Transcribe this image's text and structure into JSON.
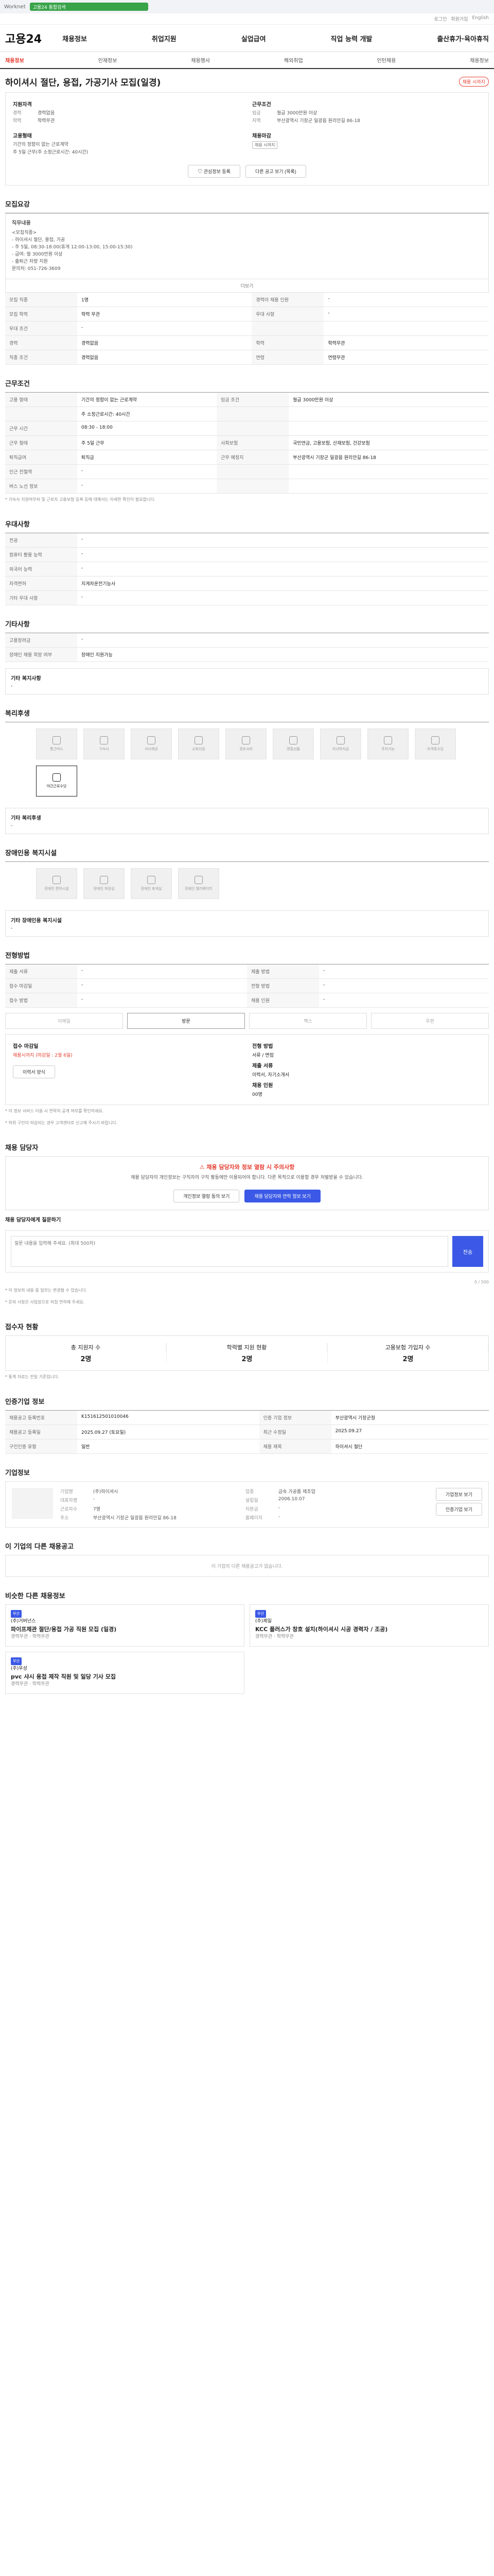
{
  "topbar": {
    "site": "Worknet",
    "search": "고용24 통합검색"
  },
  "util": [
    "로그인",
    "회원가입",
    "English"
  ],
  "header": {
    "logo": "고용24",
    "menu": [
      "채용정보",
      "취업지원",
      "실업급여",
      "직업 능력 개발",
      "출산휴가·육아휴직"
    ]
  },
  "subnav": [
    "채용정보",
    "인재정보",
    "채용행사",
    "해외취업",
    "인턴채용",
    "채용정보"
  ],
  "title": "하이셔시 절단, 용접, 가공기사 모집(일경)",
  "title_badge": "채용 시까지",
  "summary": {
    "left_label": "지원자격",
    "left": [
      [
        "경력",
        "경력없음"
      ],
      [
        "학력",
        "학력무관"
      ]
    ],
    "right_label": "근무조건",
    "right": [
      [
        "임금",
        "월급 3000만원 이상"
      ],
      [
        "지역",
        "부산광역시 기장군 일광읍 원리안길 86-18"
      ]
    ],
    "left2_label": "고용형태",
    "left2": [
      [
        "",
        "기간의 정함이 없는 근로계약"
      ],
      [
        "",
        "주 5일 근무(주 소정근로시간: 40시간)"
      ]
    ],
    "right2_label": "채용마감",
    "right2_tag": "채용 시까지"
  },
  "actions": {
    "scrap": "관심정보 등록",
    "share": "다른 공고 보기 (목록)"
  },
  "sec_requirements": "모집요강",
  "job_desc_label": "직무내용",
  "job_desc": [
    "<모집직종>",
    "- 하이셔시 절단, 용접, 가공",
    "- 주 5일, 08:30-18:00(휴게 12:00-13:00, 15:00-15:30)",
    "- 급여: 월 3000만원 이상",
    "- 출퇴근 차량 지원",
    "문의처: 051-726-3609"
  ],
  "more": "더보기",
  "req_rows": [
    [
      "모집 직종",
      "1명",
      "경력이 채용 인원",
      "-"
    ],
    [
      "모집 학력",
      "학력 무관",
      "우대 사항",
      "-"
    ],
    [
      "우대 조건",
      "-",
      "",
      ""
    ],
    [
      "경력",
      "경력없음",
      "학력",
      "학력무관"
    ],
    [
      "직종 조건",
      "경력없음",
      "연령",
      "연령무관"
    ]
  ],
  "sec_conditions": "근무조건",
  "cond_rows": [
    [
      "고용 형태",
      "기간의 정함이 없는 근로계약",
      "임금 조건",
      "월급 3000만원 이상"
    ],
    [
      "",
      "주 소정근로시간: 40시간",
      "",
      ""
    ],
    [
      "근무 시간",
      "08:30 - 18:00",
      "",
      ""
    ],
    [
      "근무 형태",
      "주 5일 근무",
      "사회보험",
      "국민연금, 고용보험, 산재보험, 건강보험"
    ],
    [
      "퇴직급여",
      "퇴직금",
      "근무 예정지",
      "부산광역시 기장군 일광읍 원리안길 86-18"
    ],
    [
      "인근 전철역",
      "-",
      "",
      ""
    ],
    [
      "버스 노선 정보",
      "-",
      "",
      ""
    ]
  ],
  "cond_note": "* 기숙사 지원여부와 및 근로자 고용보험 등록 등에 대해서는 자세한 확인이 필요합니다.",
  "sec_pref": "우대사항",
  "pref_rows": [
    [
      "전공",
      "-"
    ],
    [
      "컴퓨터 활용 능력",
      "-"
    ],
    [
      "외국어 능력",
      "-"
    ],
    [
      "자격면허",
      "지게차운전기능사"
    ],
    [
      "기타 우대 사항",
      "-"
    ]
  ],
  "sec_other": "기타사항",
  "other_rows": [
    [
      "고용장려금",
      "-"
    ],
    [
      "장애인 채용 희망 여부",
      "장애인 지원가능"
    ]
  ],
  "etc_label": "기타 복지사항",
  "etc_val": "-",
  "sec_welfare": "복리후생",
  "welfare": [
    "통근버스",
    "기숙사",
    "식사제공",
    "교육지원",
    "경조사비",
    "명절선물",
    "자녀학자금",
    "주차가능",
    "자격증수당",
    "야간근로수당"
  ],
  "welfare_other_label": "기타 복리후생",
  "welfare_other": "-",
  "sec_disabled": "장애인용 복지시설",
  "disabled": [
    "장애인 편의시설",
    "장애인 화장실",
    "장애인 휴게실",
    "장애인 엘리베이터"
  ],
  "disabled_other_label": "기타 장애인용 복지시설",
  "disabled_other": "-",
  "sec_apply": "전형방법",
  "apply_rows": [
    [
      "제출 서류",
      "-",
      "제출 방법",
      "-"
    ],
    [
      "접수 마감일",
      "-",
      "전형 방법",
      "-"
    ],
    [
      "접수 방법",
      "-",
      "채용 인원",
      "-"
    ]
  ],
  "apply_methods": [
    "이메일",
    "방문",
    "팩스",
    "우편"
  ],
  "apply_detail": {
    "deadline_label": "접수 마감일",
    "deadline": "채용시까지 (마감일 : 2월 6일)",
    "method_label": "전형 방법",
    "method": "서류 / 면접",
    "docs_label": "제출 서류",
    "docs": "이력서, 자기소개서",
    "count_label": "채용 인원",
    "count": "00명",
    "view": "이력서 양식"
  },
  "apply_notes": [
    "* 이 정보 서비스 이용 시 연락처 공개 여부를 확인하세요.",
    "* 허위 구인이 의심되는 경우 고객센터로 신고해 주시기 바랍니다."
  ],
  "sec_contact": "채용 담당자",
  "alert": {
    "head": "채용 담당자와 정보 열람 시 주의사항",
    "body": "채용 담당자의 개인정보는 구직자의 구직 활동에만 이용되어야 합니다. 다른 목적으로 이용할 경우 처벌받을 수 있습니다.",
    "btn1": "개인정보 열람 동의 보기",
    "btn2": "채용 담당자와 연락 정보 보기"
  },
  "inquiry": {
    "label": "채용 담당자에게 질문하기",
    "placeholder": "질문 내용을 입력해 주세요. (최대 500자)",
    "count": "0 / 500",
    "submit": "전송"
  },
  "inquiry_notes": [
    "* 이 정보의 내용 중 일부는 변경될 수 있습니다.",
    "* 문의 사항은 사업장으로 직접 연락해 주세요."
  ],
  "sec_stats": "접수자 현황",
  "stats": [
    {
      "k": "총 지원자 수",
      "v": "2명"
    },
    {
      "k": "학력별 지원 현황",
      "v": "2명"
    },
    {
      "k": "고용보험 가입자 수",
      "v": "2명"
    }
  ],
  "stats_note": "* 통계 자료는 전일 기준입니다.",
  "sec_meta": "인증기업 정보",
  "meta_rows": [
    [
      "채용공고 등록번호",
      "K151612501010046",
      "인증 기업 정보",
      "부산광역시 기장군청"
    ],
    [
      "채용공고 등록일",
      "2025.09.27 (토요일)",
      "최근 수정일",
      "2025.09.27"
    ],
    [
      "구인인증 유형",
      "일반",
      "채용 제목",
      "하이셔시 절단"
    ]
  ],
  "sec_company": "기업정보",
  "company": {
    "name": "(주)하이셔시",
    "grid": [
      [
        "기업명",
        "(주)하이셔시",
        "업종",
        "금속 가공품 제조업"
      ],
      [
        "대표자명",
        "-",
        "설립일",
        "2006.10.07"
      ],
      [
        "근로자수",
        "7명",
        "자본금",
        "-"
      ],
      [
        "주소",
        "부산광역시 기장군 일광읍 원리안길 86-18",
        "홈페이지",
        "-"
      ]
    ],
    "b1": "기업정보 보기",
    "b2": "인증기업 보기"
  },
  "sec_others": "이 기업의 다른 채용공고",
  "others_empty": "이 기업의 다른 채용공고가 없습니다.",
  "sec_recommend": "비슷한 다른 채용정보",
  "jobs": [
    {
      "tag": "부산",
      "company": "(주)거버넌스",
      "title": "파이프제관 절단/용접 가공 직원 모집 (일경)",
      "meta": "경력무관 · 학력무관"
    },
    {
      "tag": "부산",
      "company": "(주)제일",
      "title": "KCC 플러스가 창호 설치(하이셔시 시공 경력자 / 조공)",
      "meta": "경력무관 · 학력무관"
    },
    {
      "tag": "부산",
      "company": "(주)우성",
      "title": "pvc 샤시 용접 제작 직원 및 일당 기사 모집",
      "meta": "경력무관 · 학력무관"
    }
  ]
}
